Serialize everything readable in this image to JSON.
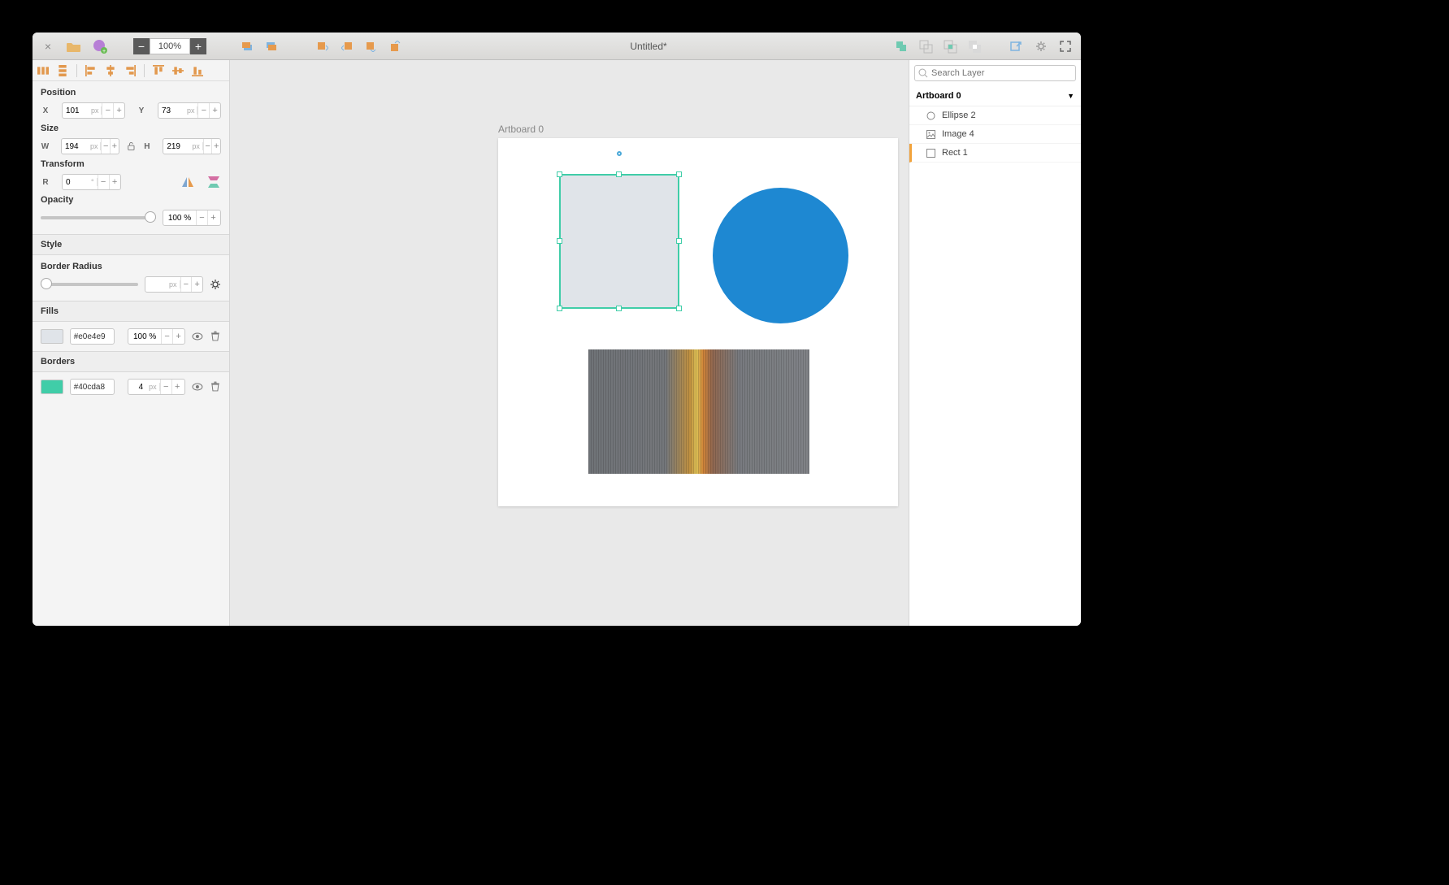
{
  "window": {
    "title": "Untitled*"
  },
  "zoom": {
    "value": "100%"
  },
  "inspector": {
    "position": {
      "label": "Position",
      "x_label": "X",
      "x": "101",
      "x_unit": "px",
      "y_label": "Y",
      "y": "73",
      "y_unit": "px"
    },
    "size": {
      "label": "Size",
      "w_label": "W",
      "w": "194",
      "w_unit": "px",
      "h_label": "H",
      "h": "219",
      "h_unit": "px"
    },
    "transform": {
      "label": "Transform",
      "r_label": "R",
      "r": "0",
      "r_unit": "°"
    },
    "opacity": {
      "label": "Opacity",
      "value": "100 %"
    },
    "style": {
      "label": "Style"
    },
    "border_radius": {
      "label": "Border Radius",
      "unit": "px"
    },
    "fills": {
      "label": "Fills",
      "hex": "#e0e4e9",
      "opacity": "100 %"
    },
    "borders": {
      "label": "Borders",
      "hex": "#40cda8",
      "width": "4",
      "width_unit": "px"
    }
  },
  "canvas": {
    "artboard_label": "Artboard 0"
  },
  "layers": {
    "search_placeholder": "Search Layer",
    "artboard": "Artboard 0",
    "items": [
      {
        "name": "Ellipse 2",
        "type": "ellipse"
      },
      {
        "name": "Image 4",
        "type": "image"
      },
      {
        "name": "Rect 1",
        "type": "rect",
        "selected": true
      }
    ]
  }
}
